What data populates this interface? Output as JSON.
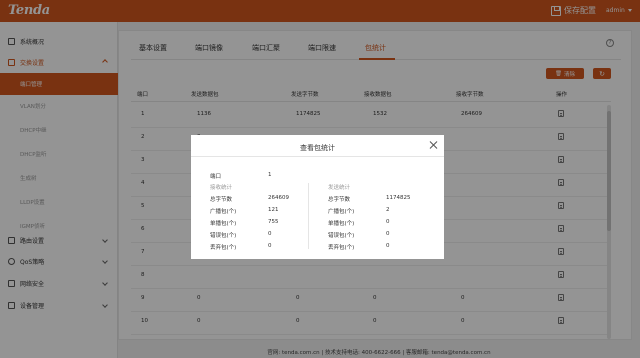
{
  "header": {
    "logo": "Tenda",
    "save_label": "保存配置",
    "save_icon": "save-icon",
    "user": "admin",
    "colors": {
      "brand": "#d0561e"
    }
  },
  "sidebar": {
    "groups": [
      {
        "label": "系统概况",
        "icon": "overview-icon"
      },
      {
        "label": "交换设置",
        "icon": "switch-icon"
      },
      {
        "label": "路由设置",
        "icon": "route-icon"
      },
      {
        "label": "QoS策略",
        "icon": "qos-icon"
      },
      {
        "label": "网络安全",
        "icon": "security-icon"
      },
      {
        "label": "设备管理",
        "icon": "device-icon"
      }
    ],
    "sub_items": [
      {
        "label": "端口管理"
      },
      {
        "label": "VLAN划分"
      },
      {
        "label": "DHCP中继"
      },
      {
        "label": "DHCP监听"
      },
      {
        "label": "生成树"
      },
      {
        "label": "LLDP设置"
      },
      {
        "label": "IGMP侦听"
      }
    ]
  },
  "tabs": [
    {
      "label": "基本设置"
    },
    {
      "label": "端口镜像"
    },
    {
      "label": "端口汇聚"
    },
    {
      "label": "端口限速"
    },
    {
      "label": "包统计"
    }
  ],
  "toolbar": {
    "clear_label": "清除",
    "clear_icon": "trash-icon",
    "refresh_icon": "refresh-icon"
  },
  "table": {
    "headers": [
      "端口",
      "发送数据包",
      "发送字节数",
      "接收数据包",
      "接收字节数",
      "操作"
    ],
    "rows": [
      {
        "port": "1",
        "tx_packets": "1136",
        "tx_bytes": "1174825",
        "rx_packets": "1532",
        "rx_bytes": "264609"
      },
      {
        "port": "2",
        "tx_packets": "0",
        "tx_bytes": "",
        "rx_packets": "",
        "rx_bytes": ""
      },
      {
        "port": "3",
        "tx_packets": "",
        "tx_bytes": "",
        "rx_packets": "",
        "rx_bytes": ""
      },
      {
        "port": "4",
        "tx_packets": "",
        "tx_bytes": "",
        "rx_packets": "",
        "rx_bytes": ""
      },
      {
        "port": "5",
        "tx_packets": "",
        "tx_bytes": "",
        "rx_packets": "",
        "rx_bytes": ""
      },
      {
        "port": "6",
        "tx_packets": "",
        "tx_bytes": "",
        "rx_packets": "",
        "rx_bytes": ""
      },
      {
        "port": "7",
        "tx_packets": "",
        "tx_bytes": "",
        "rx_packets": "",
        "rx_bytes": ""
      },
      {
        "port": "8",
        "tx_packets": "",
        "tx_bytes": "",
        "rx_packets": "",
        "rx_bytes": ""
      },
      {
        "port": "9",
        "tx_packets": "0",
        "tx_bytes": "0",
        "rx_packets": "0",
        "rx_bytes": "0"
      },
      {
        "port": "10",
        "tx_packets": "0",
        "tx_bytes": "0",
        "rx_packets": "0",
        "rx_bytes": "0"
      }
    ],
    "action_icon": "view-details-icon"
  },
  "footer": {
    "text": "官网: tenda.com.cn | 技术支持电话: 400-6622-666 | 客服邮箱: tenda@tenda.com.cn"
  },
  "modal": {
    "title": "查看包统计",
    "port_label": "端口",
    "port_value": "1",
    "rx_section": "接收统计",
    "tx_section": "发送统计",
    "rx": [
      {
        "label": "总字节数",
        "value": "264609"
      },
      {
        "label": "广播包(个)",
        "value": "121"
      },
      {
        "label": "单播包(个)",
        "value": "755"
      },
      {
        "label": "错误包(个)",
        "value": "0"
      },
      {
        "label": "丢弃包(个)",
        "value": "0"
      }
    ],
    "tx": [
      {
        "label": "总字节数",
        "value": "1174825"
      },
      {
        "label": "广播包(个)",
        "value": "2"
      },
      {
        "label": "单播包(个)",
        "value": "0"
      },
      {
        "label": "错误包(个)",
        "value": "0"
      },
      {
        "label": "丢弃包(个)",
        "value": "0"
      }
    ]
  }
}
